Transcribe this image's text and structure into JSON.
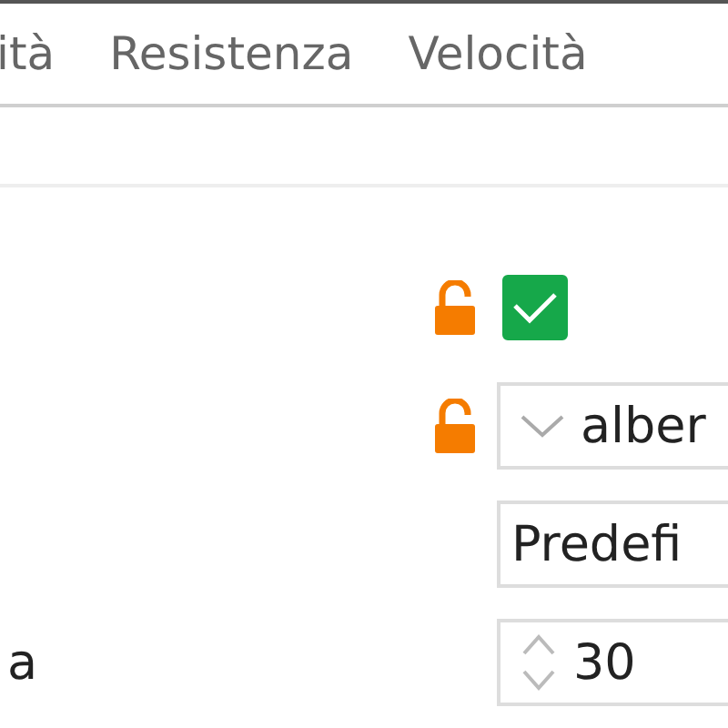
{
  "tabs": [
    {
      "label": "ità",
      "selected": false
    },
    {
      "label": "Resistenza",
      "selected": false
    },
    {
      "label": "Velocità",
      "selected": false
    }
  ],
  "rows": [
    {
      "kind": "checkbox",
      "label": "",
      "lock": {
        "locked": false
      },
      "checked": true
    },
    {
      "kind": "dropdown",
      "label": "",
      "lock": {
        "locked": false
      },
      "value": "alber"
    },
    {
      "kind": "text",
      "label": "",
      "value": "Predefi"
    },
    {
      "kind": "spinner",
      "label": "a",
      "value": "30"
    }
  ]
}
